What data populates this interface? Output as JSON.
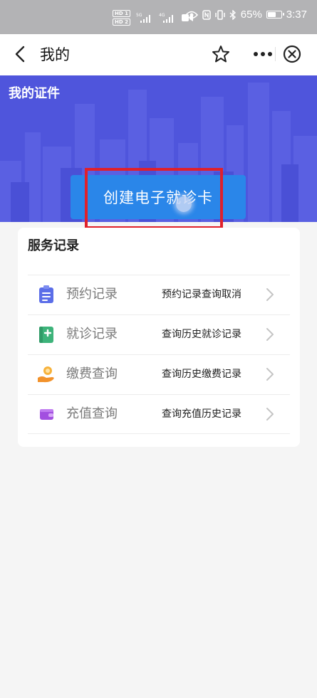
{
  "status_bar": {
    "hd1": "HD 1",
    "hd2": "HD 2",
    "net1": "5G",
    "net2": "4G",
    "battery": "65%",
    "time": "3:37"
  },
  "header": {
    "title": "我的",
    "icons": [
      "back-arrow-icon",
      "star-icon",
      "more-dots-icon",
      "close-circle-icon"
    ]
  },
  "banner": {
    "title": "我的证件",
    "create_button": "创建电子就诊卡"
  },
  "service_records": {
    "title": "服务记录",
    "items": [
      {
        "label": "预约记录",
        "desc": "预约记录查询取消",
        "icon": "clipboard-icon",
        "color": "#5b6ee8"
      },
      {
        "label": "就诊记录",
        "desc": "查询历史就诊记录",
        "icon": "medical-record-icon",
        "color": "#3db37a"
      },
      {
        "label": "缴费查询",
        "desc": "查询历史缴费记录",
        "icon": "coin-hand-icon",
        "color": "#f2922b"
      },
      {
        "label": "充值查询",
        "desc": "查询充值历史记录",
        "icon": "wallet-icon",
        "color": "#a24fe0"
      }
    ]
  },
  "colors": {
    "banner_bg": "#4f55dc",
    "button_bg": "#2a86e9",
    "highlight": "#e0202a"
  }
}
